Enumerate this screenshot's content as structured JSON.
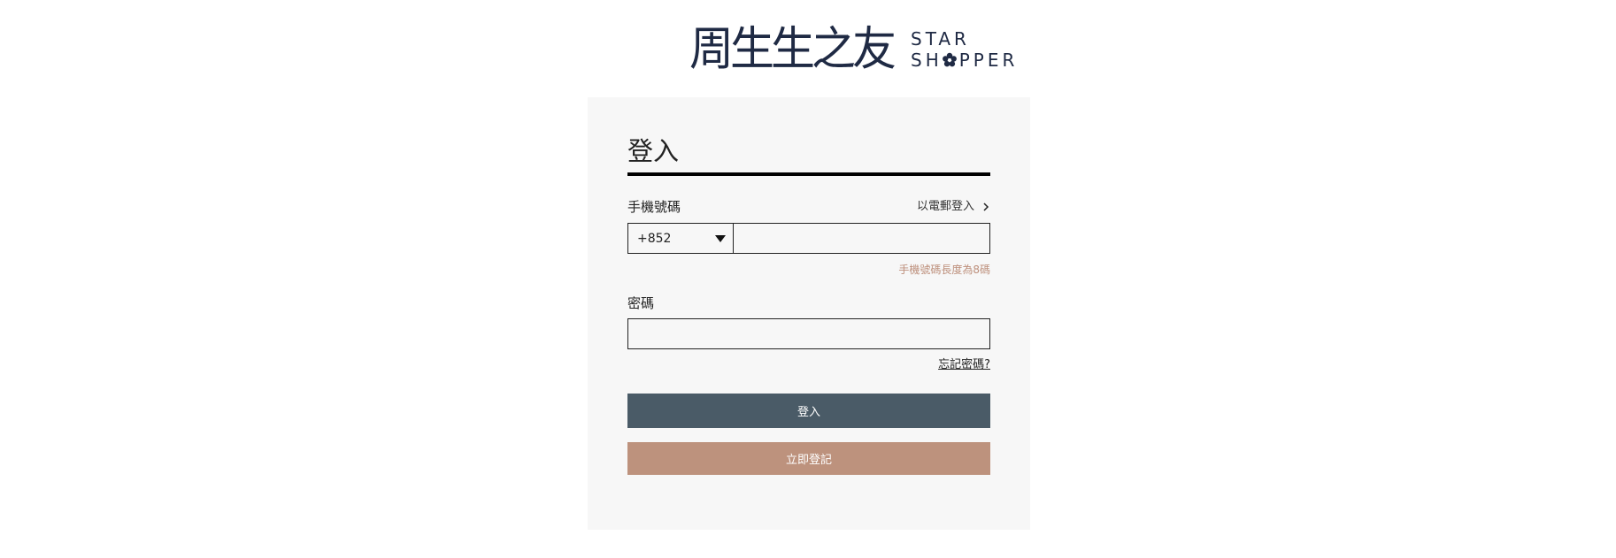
{
  "brand": {
    "logo_cn": "周生生之友",
    "logo_en_line1": "STAR",
    "logo_en_line2_left": "SH",
    "logo_en_line2_right": "PPER"
  },
  "login": {
    "title": "登入",
    "phone_label": "手機號碼",
    "email_login_link": "以電郵登入",
    "country_code": "+852",
    "phone_value": "",
    "phone_hint": "手機號碼長度為8碼",
    "password_label": "密碼",
    "password_value": "",
    "forgot_password": "忘記密碼?",
    "login_button": "登入",
    "register_button": "立即登記"
  },
  "colors": {
    "card_bg": "#f7f7f7",
    "login_button": "#4a5b67",
    "register_button": "#bd927d",
    "hint_text": "#bd8f7b",
    "logo": "#1f2a44"
  },
  "icons": {
    "email_link_icon": "chevron-right-icon",
    "country_dropdown_icon": "caret-down-icon",
    "logo_o_icon": "flower-icon"
  }
}
